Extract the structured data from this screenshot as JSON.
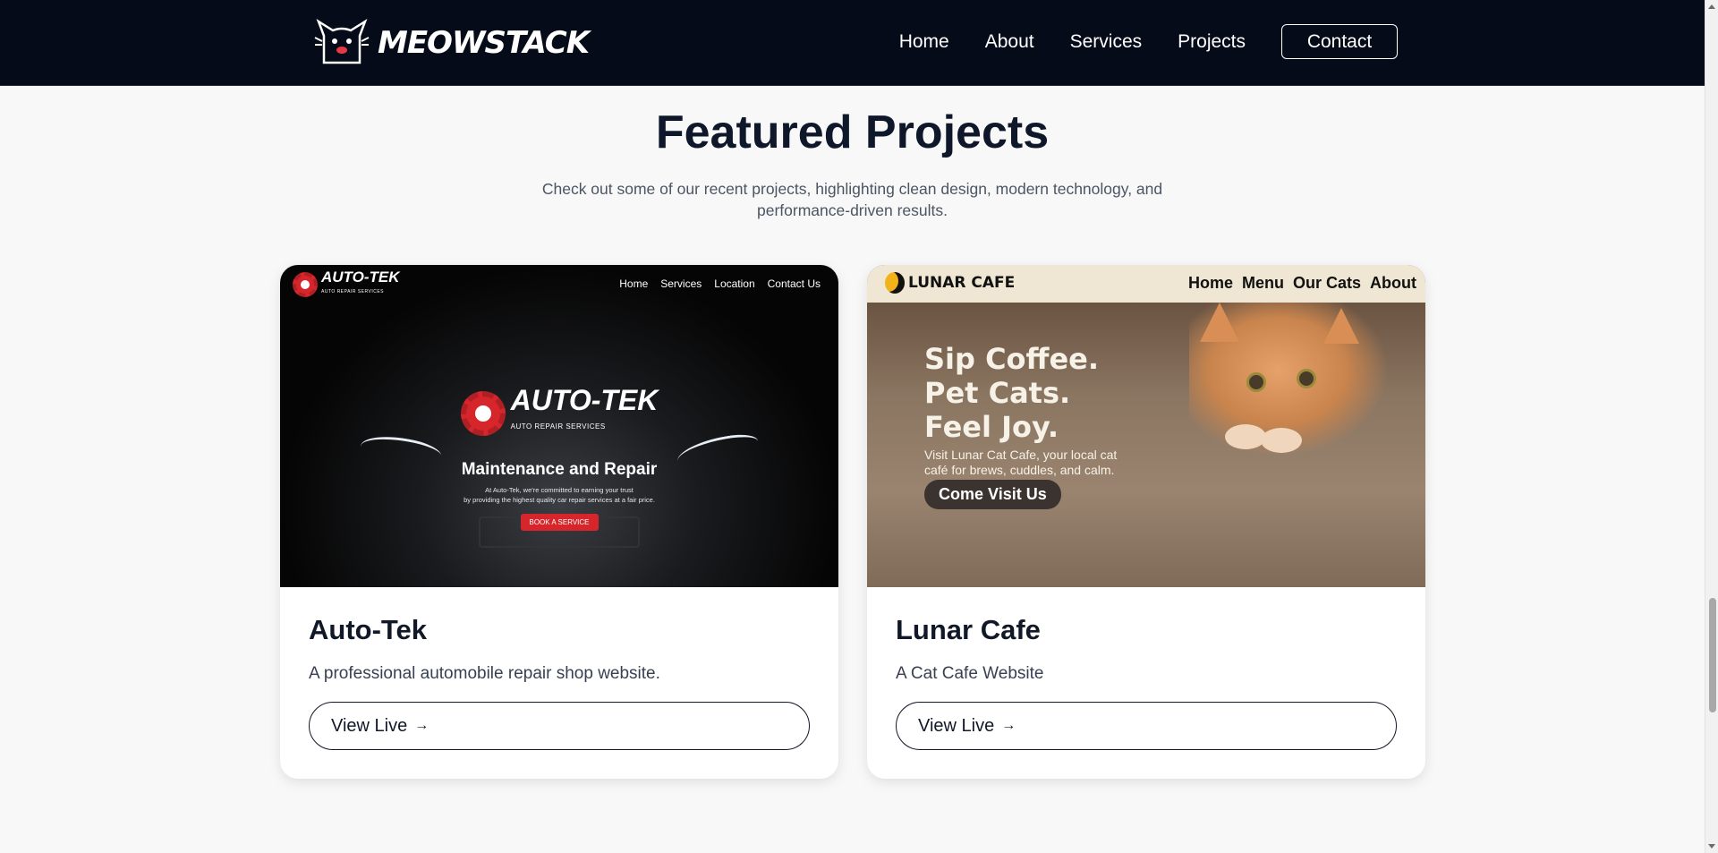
{
  "nav": {
    "brand": "MEOWSTACK",
    "links": [
      "Home",
      "About",
      "Services",
      "Projects"
    ],
    "contact_label": "Contact"
  },
  "section": {
    "title": "Featured Projects",
    "subtitle": "Check out some of our recent projects, highlighting clean design, modern technology, and performance-driven results."
  },
  "projects": [
    {
      "title": "Auto-Tek",
      "description": "A professional automobile repair shop website.",
      "button_label": "View Live",
      "button_arrow": "→",
      "thumbnail": {
        "brand": "AUTO-TEK",
        "brand_sub": "AUTO REPAIR SERVICES",
        "nav": [
          "Home",
          "Services",
          "Location",
          "Contact Us"
        ],
        "heading": "Maintenance and Repair",
        "text_line1": "At Auto-Tek, we're committed to earning your trust",
        "text_line2": "by providing the highest quality car repair services at a fair price.",
        "cta": "BOOK A SERVICE"
      }
    },
    {
      "title": "Lunar Cafe",
      "description": "A Cat Cafe Website",
      "button_label": "View Live",
      "button_arrow": "→",
      "thumbnail": {
        "brand": "LUNAR CAFE",
        "nav": [
          "Home",
          "Menu",
          "Our Cats",
          "About"
        ],
        "heading_lines": [
          "Sip Coffee.",
          "Pet Cats.",
          "Feel Joy."
        ],
        "text_line1": "Visit Lunar Cat Cafe, your local cat",
        "text_line2": "café for brews, cuddles, and calm.",
        "cta": "Come Visit Us"
      }
    }
  ],
  "colors": {
    "nav_bg": "#050b18",
    "page_bg": "#f8f8f8",
    "accent_red": "#d6262b"
  }
}
